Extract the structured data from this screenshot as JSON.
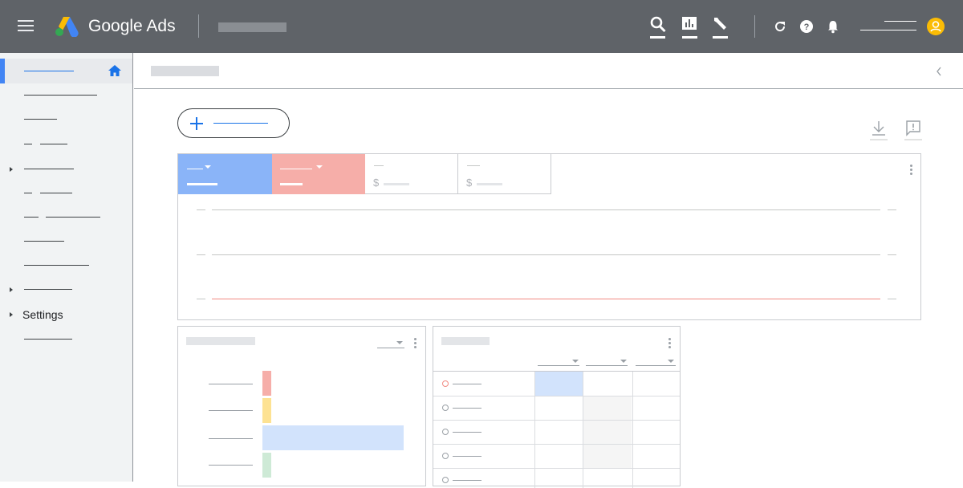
{
  "header": {
    "app_name": "Google Ads",
    "menu_icon": "hamburger-menu-icon",
    "logo_icon": "google-ads-logo-icon",
    "tools": [
      {
        "name": "search-icon"
      },
      {
        "name": "reports-icon"
      },
      {
        "name": "tools-wrench-icon"
      }
    ],
    "actions": [
      {
        "name": "refresh-icon"
      },
      {
        "name": "help-icon"
      },
      {
        "name": "notifications-bell-icon"
      }
    ],
    "avatar_icon": "account-avatar-icon"
  },
  "sidebar": {
    "active_icon": "home-icon",
    "settings_label": "Settings"
  },
  "colors": {
    "header_bg": "#5f6368",
    "accent_blue": "#1a73e8",
    "metric_blue": "#8ab4f8",
    "metric_red": "#f6aea9",
    "avatar_yellow": "#fbbc04"
  },
  "main": {
    "create_button_icon": "plus-icon",
    "download_icon": "download-icon",
    "feedback_icon": "feedback-icon",
    "collapse_icon": "chevron-left-icon",
    "metric_currency_symbol": "$"
  },
  "bar_chart": {
    "bar_colors": [
      "#f6aea9",
      "#fde293",
      "#d2e3fc",
      "#ceead6"
    ],
    "values": [
      0.18,
      0.18,
      1.0,
      0.18
    ]
  }
}
